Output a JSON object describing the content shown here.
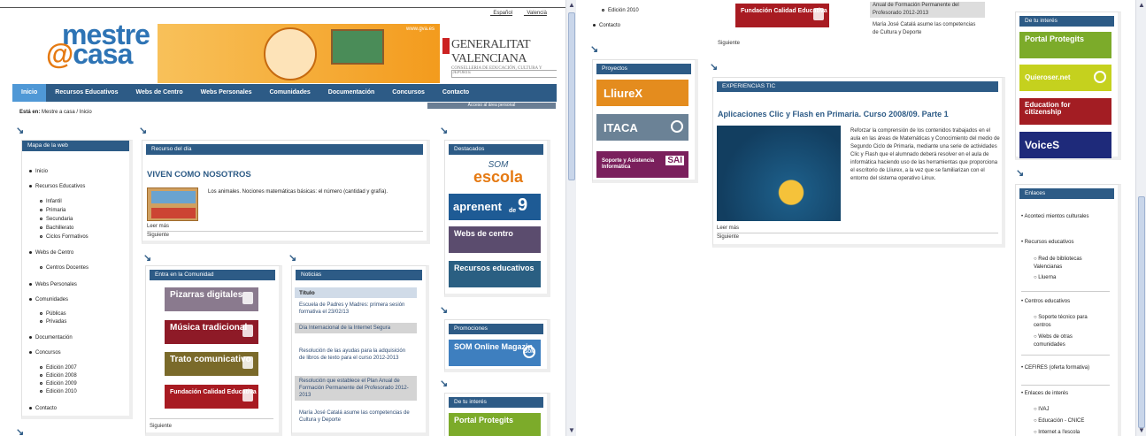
{
  "lang": {
    "es": "_Español",
    "va": "_Valencià"
  },
  "logo": {
    "l1": "mestre",
    "at": "@",
    "l2": "casa"
  },
  "banner_url": "www.gva.es",
  "gva": {
    "name": "GENERALITAT VALENCIANA",
    "sub": "CONSELLERIA DE EDUCACIÓN, CULTURA Y DEPORTE"
  },
  "search_btn": "Q",
  "nav": {
    "inicio": "Inicio",
    "recursos": "Recursos Educativos",
    "webs_centro": "Webs de Centro",
    "webs_personales": "Webs Personales",
    "comunidades": "Comunidades",
    "documentacion": "Documentación",
    "concursos": "Concursos",
    "contacto": "Contacto"
  },
  "area_personal": "Acceso al área personal",
  "crumb": {
    "label": "Está en:",
    "path": "Mestre a casa / Inicio"
  },
  "arrow": "↘",
  "mapa": {
    "title": "Mapa de la web",
    "items": [
      "Inicio",
      "Recursos Educativos",
      "Infantil",
      "Primaria",
      "Secundaria",
      "Bachillerato",
      "Ciclos Formativos",
      "Webs de Centro",
      "Centros Docentes",
      "Webs Personales",
      "Comunidades",
      "Públicas",
      "Privadas",
      "Documentación",
      "Concursos",
      "Edición 2007",
      "Edición 2008",
      "Edición 2009",
      "Edición 2010",
      "Contacto"
    ]
  },
  "dia": {
    "title": "Recurso del día",
    "headline": "VIVEN COMO NOSOTROS",
    "desc": "Los animales. Nociones matemáticas básicas: el número (cantidad y grafía).",
    "more": "Leer más",
    "next": "Siguiente"
  },
  "comunidad": {
    "title": "Entra en la Comunidad",
    "tiles": [
      "Pizarras digitales",
      "Música tradicional",
      "Trato comunicativo",
      "Fundación Calidad Educativa"
    ],
    "next": "Siguiente"
  },
  "noticias": {
    "title": "Noticias",
    "col": "Título",
    "items": [
      "Escuela de Padres y Madres: primera sesión formativa el 23/02/13",
      "Día Internacional de la Internet Segura",
      "Resolución de las ayudas para la adquisición de libros de texto para el curso 2012-2013",
      "Resolución que establece el Plan Anual de Formación Permanente del Profesorado 2012-2013",
      "María José Catalá asume las competencias de Cultura y Deporte"
    ]
  },
  "destacados": {
    "title": "Destacados",
    "som": "SOM",
    "escola": "escola",
    "aprenent": "aprenent",
    "aprenent_sub": "de",
    "aprenent_num": "9",
    "webs": "Webs de centro",
    "recursos": "Recursos educativos"
  },
  "promociones": {
    "title": "Promociones",
    "tile": "SOM Online Magazin",
    "badge": "SOM"
  },
  "interes_left": {
    "title": "De tu interés",
    "tile": "Portal Protegits"
  },
  "right": {
    "top_edicion": "Edición 2010",
    "top_contacto": "Contacto",
    "top_news": [
      "Anual de Formación Permanente del Profesorado 2012-2013",
      "María José Catalá asume las competencias de Cultura y Deporte"
    ],
    "next": "Siguiente",
    "proyectos": {
      "title": "Proyectos",
      "tiles": [
        "LliureX",
        "ITACA",
        "Soporte y Asistencia Informática"
      ],
      "sai_badge": "SAI"
    },
    "exp": {
      "title": "EXPERIENCIAS TIC",
      "headline": "Aplicaciones Clic y Flash en Primaria. Curso 2008/09. Parte 1",
      "desc": "Reforzar la comprensión de los contenidos trabajados en el aula en las áreas de Matemáticas y Conocimiento del medio de Segundo Ciclo de Primaria, mediante una serie de actividades Clic y Flash que el alumnado deberá resolver en el aula de informática haciendo uso de las herramientas que proporciona el escritorio de Lliurex, a la vez que se familiarizan con el entorno del sistema operativo Linux.",
      "more": "Leer más",
      "next": "Siguiente"
    },
    "interes": {
      "title": "De tu interés",
      "tiles": [
        "Portal Protegits",
        "Quieroser.net",
        "Education for citizenship",
        "VoiceS"
      ]
    },
    "enlaces": {
      "title": "Enlaces",
      "items": [
        "Aconteci mientos culturales",
        "Recursos educativos",
        "Red de bibliotecas Valencianas",
        "Lluerna",
        "Centros educativos",
        "Soporte técnico para centros",
        "Webs de otras comunidades",
        "CEFIRES (oferta formativa)",
        "Enlaces de interés",
        "IVAJ",
        "Educación - CNICE",
        "Internet a l'escola"
      ]
    }
  },
  "colors": {
    "nav": "#2d5b86",
    "nav_active": "#4f98d6",
    "accent": "#e57a13"
  }
}
